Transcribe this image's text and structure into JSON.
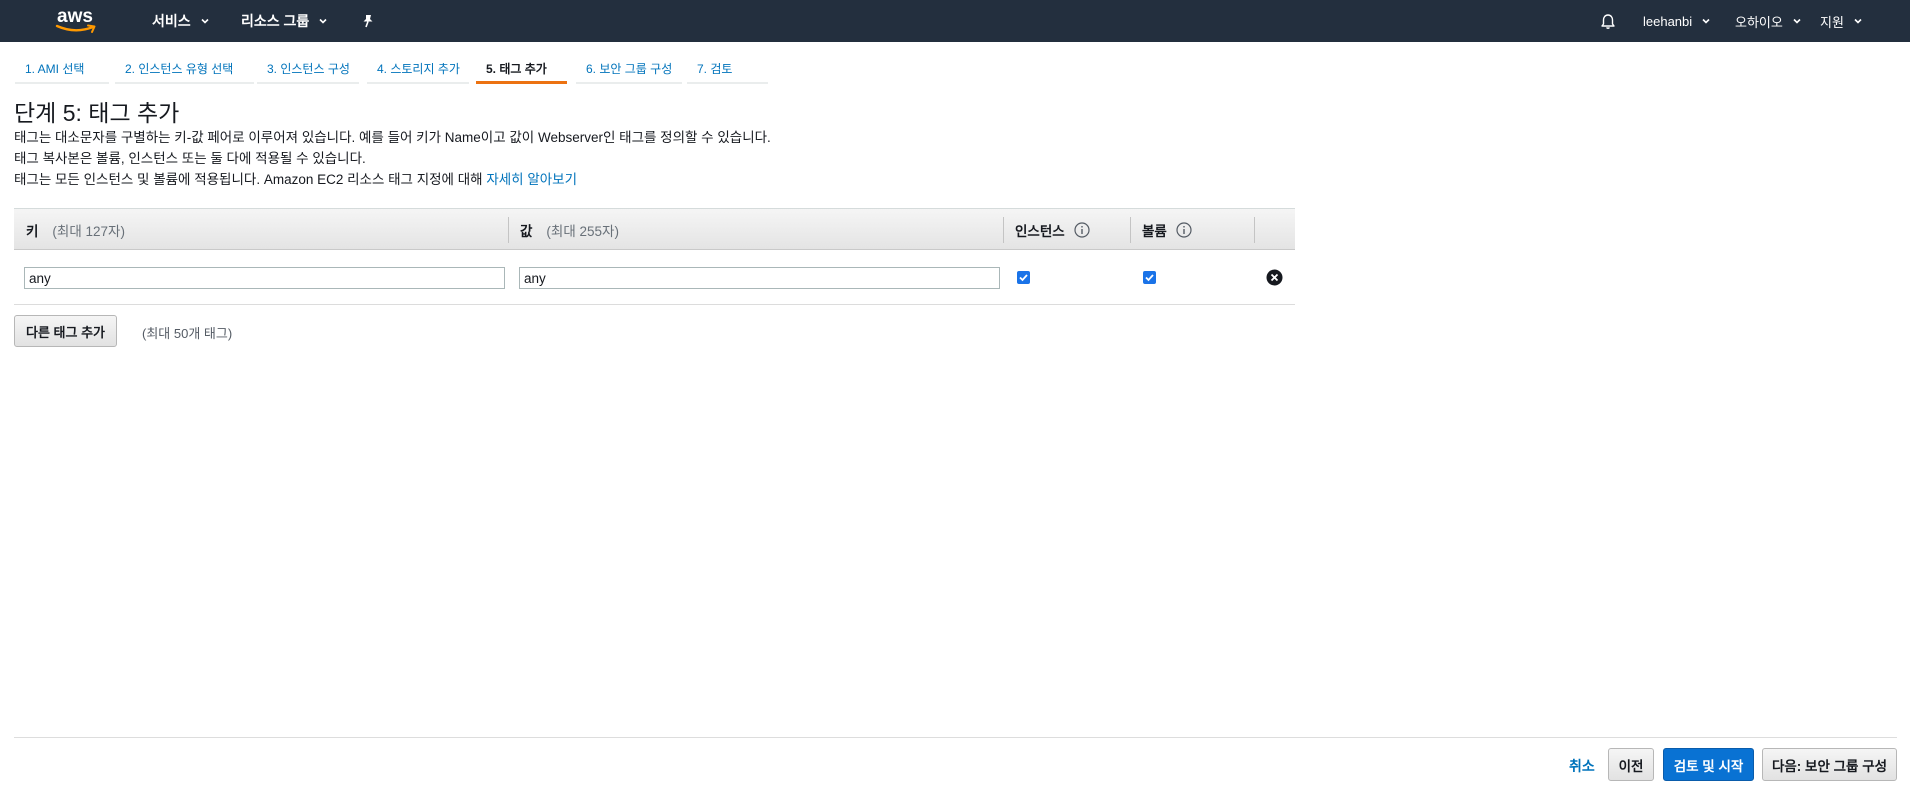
{
  "topnav": {
    "logo_text": "aws",
    "services_label": "서비스",
    "resource_groups_label": "리소스 그룹",
    "username": "leehanbi",
    "region": "오하이오",
    "support": "지원",
    "icons": [
      "caret-down-icon",
      "pin-icon",
      "bell-icon"
    ]
  },
  "wizard": {
    "steps": [
      {
        "label": "1. AMI 선택"
      },
      {
        "label": "2. 인스턴스 유형 선택"
      },
      {
        "label": "3. 인스턴스 구성"
      },
      {
        "label": "4. 스토리지 추가"
      },
      {
        "label": "5. 태그 추가"
      },
      {
        "label": "6. 보안 그룹 구성"
      },
      {
        "label": "7. 검토"
      }
    ],
    "active_index": 4,
    "active_color": "#ec7211"
  },
  "page": {
    "title": "단계 5: 태그 추가",
    "desc1": "태그는 대소문자를 구별하는 키-값 페어로 이루어져 있습니다. 예를 들어 키가 Name이고 값이 Webserver인 태그를 정의할 수 있습니다.",
    "desc2": "태그 복사본은 볼륨, 인스턴스 또는 둘 다에 적용될 수 있습니다.",
    "desc3": "태그는 모든 인스턴스 및 볼륨에 적용됩니다. Amazon EC2 리소스 태그 지정에 대해 ",
    "learn_more": "자세히 알아보기"
  },
  "table": {
    "key_header": "키",
    "key_hint": "(최대 127자)",
    "value_header": "값",
    "value_hint": "(최대 255자)",
    "instances_header": "인스턴스",
    "volumes_header": "볼륨",
    "rows": [
      {
        "key": "any",
        "value": "any",
        "instances": true,
        "volumes": true
      }
    ]
  },
  "add_tag": {
    "button_label": "다른 태그 추가",
    "limit_note": "(최대 50개 태그)"
  },
  "footer": {
    "cancel": "취소",
    "previous": "이전",
    "review_launch": "검토 및 시작",
    "next": "다음: 보안 그룹 구성"
  },
  "colors": {
    "nav_bg": "#232f3e",
    "link": "#0073bb",
    "primary_button": "#0972d3",
    "accent": "#ec7211"
  }
}
